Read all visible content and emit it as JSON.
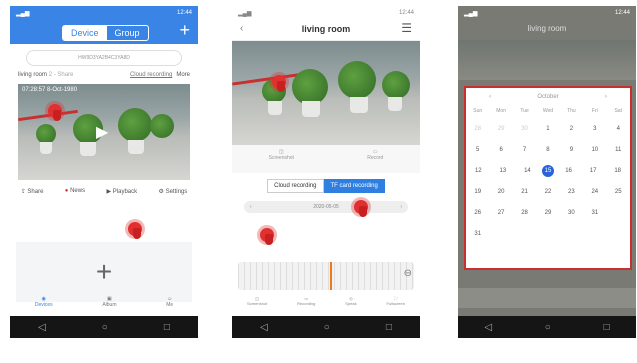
{
  "phone1": {
    "tabs": [
      "Device",
      "Group"
    ],
    "add_icon": "plus-icon",
    "device_id": "HW9D3YA2B4C3YA8D",
    "room_label": "living room",
    "room_meta": "2 - Share",
    "cloud_link": "Cloud recording",
    "more_link": "More",
    "timestamp": "07:28:57 8-Oct-1980",
    "actions": [
      "Share",
      "News",
      "Playback",
      "Settings"
    ],
    "bottom_nav": [
      "Devices",
      "Album",
      "Me"
    ]
  },
  "phone2": {
    "title": "living room",
    "back_icon": "back-arrow-icon",
    "menu_icon": "menu-icon",
    "controls": [
      "Screenshot",
      "Record"
    ],
    "rec_tabs": [
      "Cloud recording",
      "TF card recording"
    ],
    "date_text": "2020-05-05",
    "bottom_nav": [
      "Screenshot",
      "Recording",
      "Speak",
      "Fullscreen"
    ]
  },
  "phone3": {
    "title": "living room",
    "month": "October",
    "weekdays": [
      "Sun",
      "Mon",
      "Tue",
      "Wed",
      "Thu",
      "Fri",
      "Sat"
    ],
    "days": [
      [
        "28",
        "29",
        "30",
        "1",
        "2",
        "3",
        "4"
      ],
      [
        "5",
        "6",
        "7",
        "8",
        "9",
        "10",
        "11"
      ],
      [
        "12",
        "13",
        "14",
        "15",
        "16",
        "17",
        "18"
      ],
      [
        "19",
        "20",
        "21",
        "22",
        "23",
        "24",
        "25"
      ],
      [
        "26",
        "27",
        "28",
        "29",
        "30",
        "31",
        ""
      ],
      [
        "31",
        "",
        "",
        "",
        "",
        "",
        ""
      ]
    ],
    "selected_day": "15",
    "accent": "#2a63d8"
  },
  "colors": {
    "blue": "#2f7fe0",
    "red": "#e03030",
    "orange": "#f07a1a"
  }
}
